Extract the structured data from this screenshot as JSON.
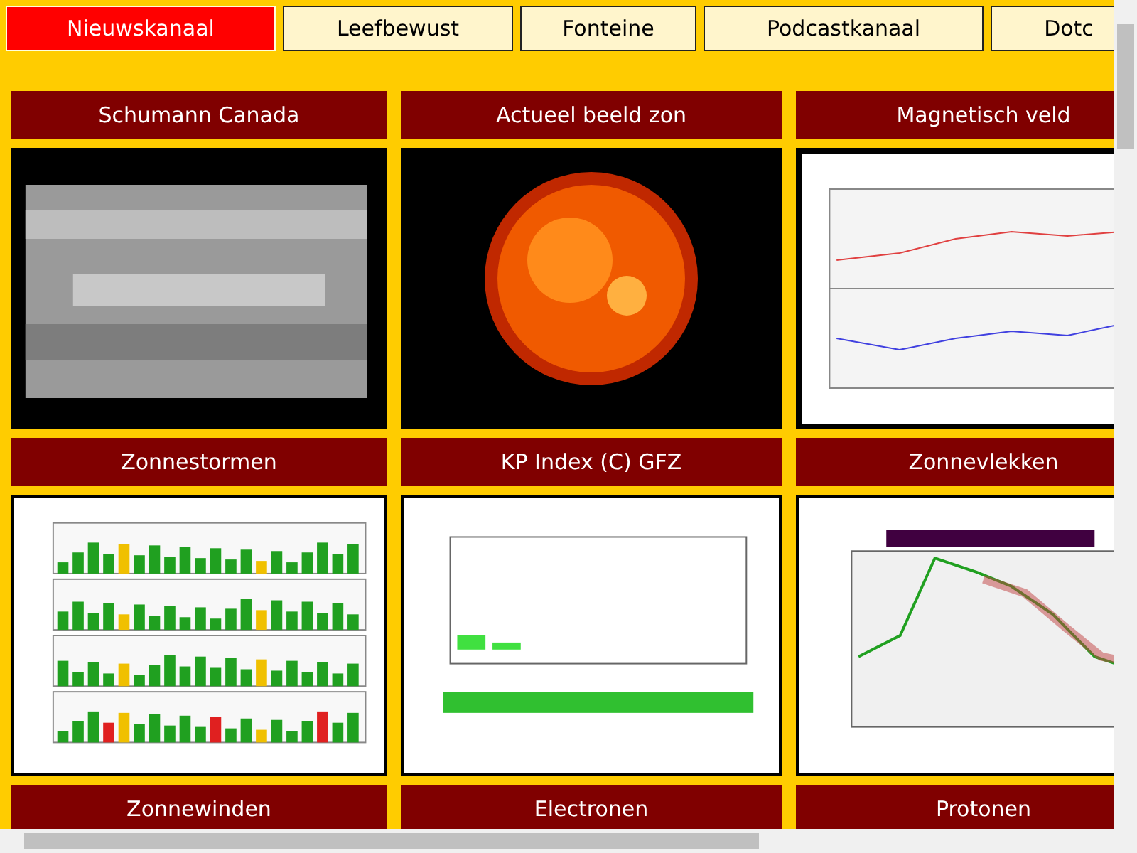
{
  "tabs": [
    {
      "label": "Nieuwskanaal",
      "selected": true
    },
    {
      "label": "Leefbewust",
      "selected": false
    },
    {
      "label": "Fonteine",
      "selected": false
    },
    {
      "label": "Podcastkanaal",
      "selected": false
    },
    {
      "label": "Dotc",
      "selected": false
    }
  ],
  "panels": [
    {
      "title": "Schumann Canada"
    },
    {
      "title": "Actueel beeld zon"
    },
    {
      "title": "Magnetisch veld"
    },
    {
      "title": "Zonnestormen"
    },
    {
      "title": "KP Index (C) GFZ"
    },
    {
      "title": "Zonnevlekken"
    },
    {
      "title": "Zonnewinden"
    },
    {
      "title": "Electronen"
    },
    {
      "title": "Protonen"
    }
  ]
}
